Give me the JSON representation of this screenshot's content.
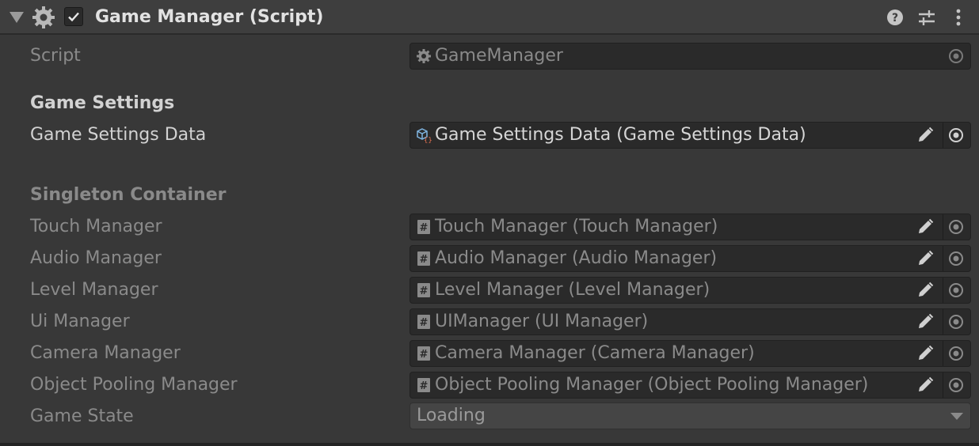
{
  "component": {
    "title": "Game Manager (Script)",
    "enabled": true,
    "icons": [
      "foldout-arrow-icon",
      "script-gear-icon",
      "help-icon",
      "preset-sliders-icon",
      "kebab-menu-icon"
    ]
  },
  "script_row": {
    "label": "Script",
    "value": "GameManager",
    "icon": "script-gear-icon"
  },
  "game_settings": {
    "header": "Game Settings",
    "data_label": "Game Settings Data",
    "data_value": "Game Settings Data (Game Settings Data)",
    "data_icon": "scriptable-object-icon"
  },
  "singleton": {
    "header": "Singleton Container",
    "rows": [
      {
        "label": "Touch Manager",
        "value": "Touch Manager (Touch Manager)"
      },
      {
        "label": "Audio Manager",
        "value": "Audio Manager (Audio Manager)"
      },
      {
        "label": "Level Manager",
        "value": "Level Manager (Level Manager)"
      },
      {
        "label": "Ui Manager",
        "value": "UIManager (UI Manager)"
      },
      {
        "label": "Camera Manager",
        "value": "Camera Manager (Camera Manager)"
      },
      {
        "label": "Object Pooling Manager",
        "value": "Object Pooling Manager (Object Pooling Manager)"
      }
    ]
  },
  "game_state": {
    "label": "Game State",
    "value": "Loading"
  },
  "colors": {
    "background": "#383838",
    "header": "#3e3e3e",
    "field": "#2a2a2a"
  }
}
